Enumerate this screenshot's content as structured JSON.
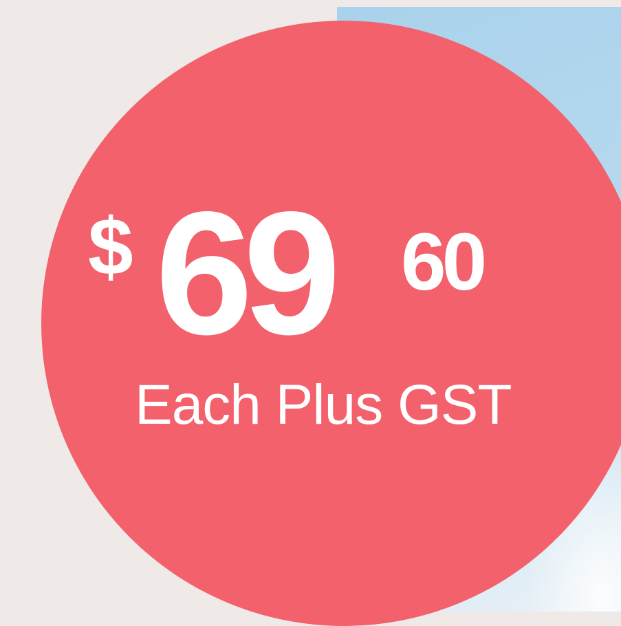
{
  "price": {
    "currency_symbol": "$",
    "dollars": "69",
    "cents": "60",
    "note": "Each Plus GST"
  },
  "colors": {
    "background": "#efe9e8",
    "badge": "#f2616c",
    "text": "#ffffff",
    "photo": "#a9d2ec"
  }
}
